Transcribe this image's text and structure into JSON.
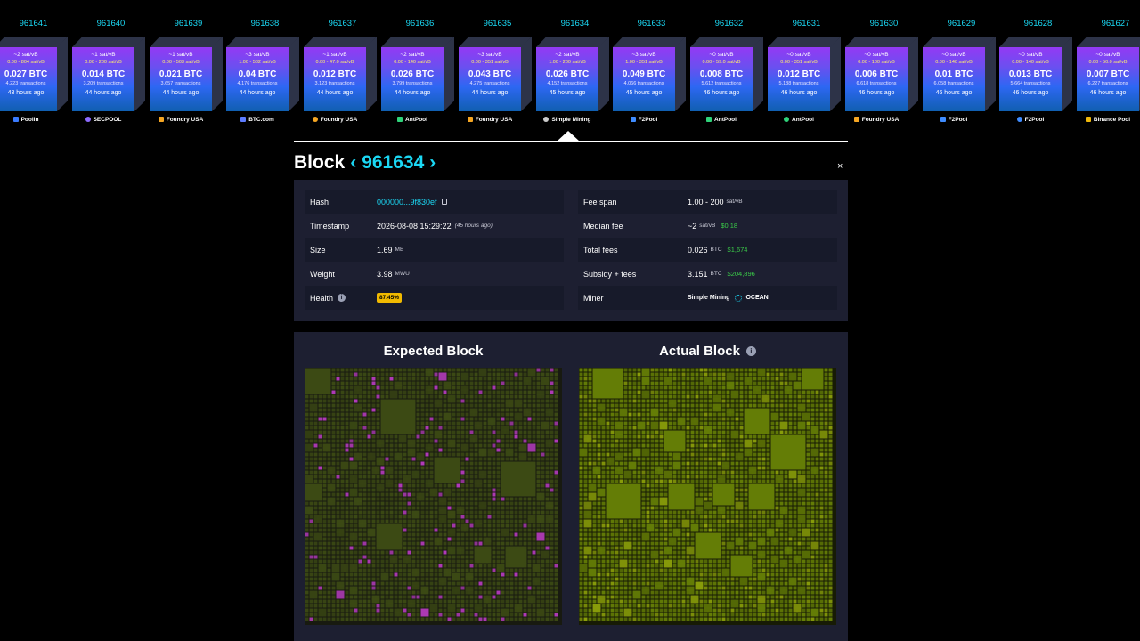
{
  "blocks": [
    {
      "height": "961641",
      "fee": "~2 sat/vB",
      "span": "0.00 - 804 sat/vB",
      "total": "0.027 BTC",
      "tx": "4,223 transactions",
      "time": "43 hours ago",
      "pool": "Poolin",
      "icon": "poolin-icon",
      "iconColor": "#3a7bff"
    },
    {
      "height": "961640",
      "fee": "~1 sat/vB",
      "span": "0.00 - 200 sat/vB",
      "total": "0.014 BTC",
      "tx": "3,209 transactions",
      "time": "44 hours ago",
      "pool": "SECPOOL",
      "icon": "secpool-icon",
      "iconColor": "#8d6bff"
    },
    {
      "height": "961639",
      "fee": "~1 sat/vB",
      "span": "0.00 - 503 sat/vB",
      "total": "0.021 BTC",
      "tx": "3,657 transactions",
      "time": "44 hours ago",
      "pool": "Foundry USA",
      "icon": "foundry-icon",
      "iconColor": "#f5a623"
    },
    {
      "height": "961638",
      "fee": "~3 sat/vB",
      "span": "1.00 - 502 sat/vB",
      "total": "0.04 BTC",
      "tx": "4,176 transactions",
      "time": "44 hours ago",
      "pool": "BTC.com",
      "icon": "btccom-icon",
      "iconColor": "#5d7cff"
    },
    {
      "height": "961637",
      "fee": "~1 sat/vB",
      "span": "0.00 - 47.0 sat/vB",
      "total": "0.012 BTC",
      "tx": "3,123 transactions",
      "time": "44 hours ago",
      "pool": "Foundry USA",
      "icon": "foundry-icon",
      "iconColor": "#f5a623"
    },
    {
      "height": "961636",
      "fee": "~2 sat/vB",
      "span": "0.00 - 140 sat/vB",
      "total": "0.026 BTC",
      "tx": "3,799 transactions",
      "time": "44 hours ago",
      "pool": "AntPool",
      "icon": "antpool-icon",
      "iconColor": "#2fd37a"
    },
    {
      "height": "961635",
      "fee": "~3 sat/vB",
      "span": "0.00 - 351 sat/vB",
      "total": "0.043 BTC",
      "tx": "4,275 transactions",
      "time": "44 hours ago",
      "pool": "Foundry USA",
      "icon": "foundry-icon",
      "iconColor": "#f5a623"
    },
    {
      "height": "961634",
      "fee": "~2 sat/vB",
      "span": "1.00 - 200 sat/vB",
      "total": "0.026 BTC",
      "tx": "4,152 transactions",
      "time": "45 hours ago",
      "pool": "Simple Mining",
      "icon": "simple-mining-icon",
      "iconColor": "#cccccc"
    },
    {
      "height": "961633",
      "fee": "~3 sat/vB",
      "span": "1.00 - 351 sat/vB",
      "total": "0.049 BTC",
      "tx": "4,066 transactions",
      "time": "45 hours ago",
      "pool": "F2Pool",
      "icon": "f2pool-icon",
      "iconColor": "#3f8cff"
    },
    {
      "height": "961632",
      "fee": "~0 sat/vB",
      "span": "0.00 - 59.0 sat/vB",
      "total": "0.008 BTC",
      "tx": "5,612 transactions",
      "time": "46 hours ago",
      "pool": "AntPool",
      "icon": "antpool-icon",
      "iconColor": "#2fd37a"
    },
    {
      "height": "961631",
      "fee": "~0 sat/vB",
      "span": "0.00 - 351 sat/vB",
      "total": "0.012 BTC",
      "tx": "5,188 transactions",
      "time": "46 hours ago",
      "pool": "AntPool",
      "icon": "antpool-icon",
      "iconColor": "#2fd37a"
    },
    {
      "height": "961630",
      "fee": "~0 sat/vB",
      "span": "0.00 - 100 sat/vB",
      "total": "0.006 BTC",
      "tx": "6,618 transactions",
      "time": "46 hours ago",
      "pool": "Foundry USA",
      "icon": "foundry-icon",
      "iconColor": "#f5a623"
    },
    {
      "height": "961629",
      "fee": "~0 sat/vB",
      "span": "0.00 - 140 sat/vB",
      "total": "0.01 BTC",
      "tx": "6,058 transactions",
      "time": "46 hours ago",
      "pool": "F2Pool",
      "icon": "f2pool-icon",
      "iconColor": "#3f8cff"
    },
    {
      "height": "961628",
      "fee": "~0 sat/vB",
      "span": "0.00 - 140 sat/vB",
      "total": "0.013 BTC",
      "tx": "5,664 transactions",
      "time": "46 hours ago",
      "pool": "F2Pool",
      "icon": "f2pool-icon",
      "iconColor": "#3f8cff"
    },
    {
      "height": "961627",
      "fee": "~0 sat/vB",
      "span": "0.00 - 50.0 sat/vB",
      "total": "0.007 BTC",
      "tx": "6,227 transactions",
      "time": "46 hours ago",
      "pool": "Binance Pool",
      "icon": "binance-icon",
      "iconColor": "#f0b90b"
    }
  ],
  "selected_index": 7,
  "header": {
    "title": "Block",
    "prev_glyph": "‹",
    "number": "961634",
    "next_glyph": "›",
    "close_glyph": "×"
  },
  "details": {
    "left": {
      "hash_label": "Hash",
      "hash_value": "000000...9f830ef",
      "timestamp_label": "Timestamp",
      "timestamp_value": "2026-08-08 15:29:22",
      "timestamp_ago": "(45 hours ago)",
      "size_label": "Size",
      "size_value": "1.69",
      "size_unit": "MB",
      "weight_label": "Weight",
      "weight_value": "3.98",
      "weight_unit": "MWU",
      "health_label": "Health",
      "health_info": "i",
      "health_value": "87.45%"
    },
    "right": {
      "feespan_label": "Fee span",
      "feespan_value": "1.00 - 200",
      "feespan_unit": "sat/vB",
      "median_label": "Median fee",
      "median_value": "~2",
      "median_unit": "sat/vB",
      "median_usd": "$0.18",
      "total_label": "Total fees",
      "total_value": "0.026",
      "total_unit": "BTC",
      "total_usd": "$1,674",
      "subsidy_label": "Subsidy + fees",
      "subsidy_value": "3.151",
      "subsidy_unit": "BTC",
      "subsidy_usd": "$204,896",
      "miner_label": "Miner",
      "miner_value": "Simple Mining",
      "miner_extra": "OCEAN"
    }
  },
  "audit": {
    "expected_title": "Expected Block",
    "actual_title": "Actual Block",
    "actual_info": "i"
  },
  "colors": {
    "accent": "#1bd8f4",
    "usd": "#3bcc49",
    "health": "#f0b900",
    "expected_tx": "#3c4a14",
    "expected_highlight": "#b13bb8",
    "actual_tx": "#647d06"
  }
}
